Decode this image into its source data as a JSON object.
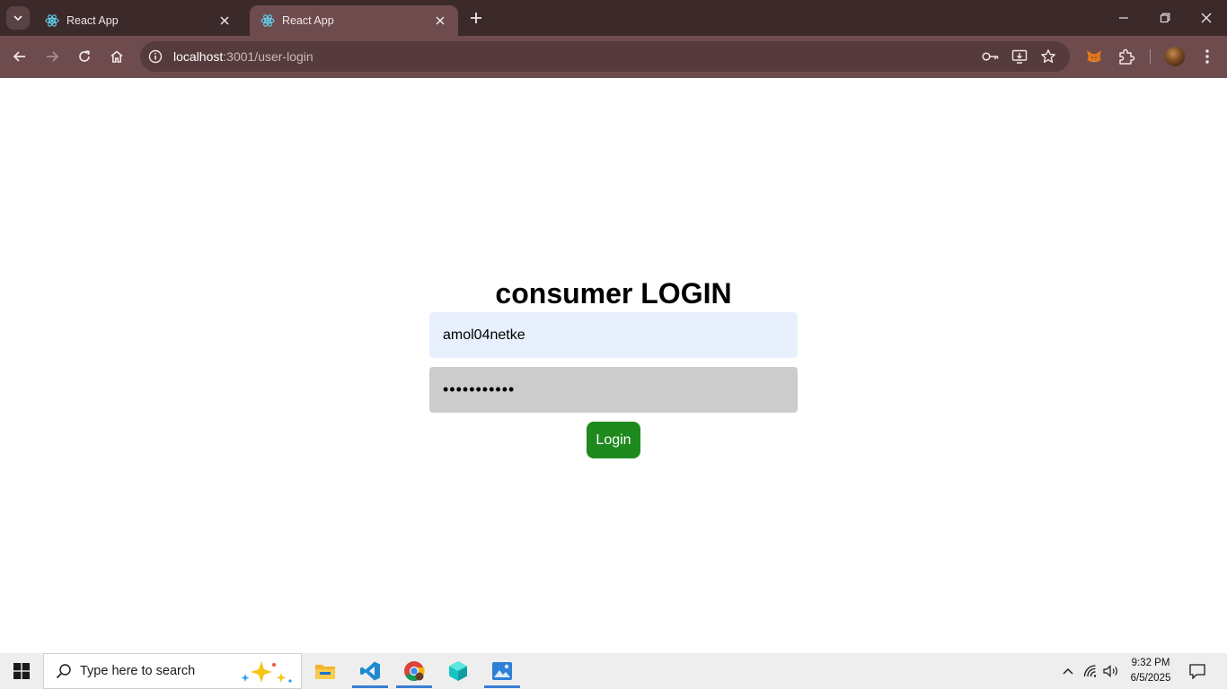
{
  "browser": {
    "tabs": [
      {
        "title": "React App",
        "active": false
      },
      {
        "title": "React App",
        "active": true
      }
    ],
    "url_host": "localhost",
    "url_rest": ":3001/user-login"
  },
  "page": {
    "title": "consumer LOGIN",
    "username_value": "amol04netke",
    "password_masked": "•••••••••••",
    "login_label": "Login"
  },
  "taskbar": {
    "search_placeholder": "Type here to search",
    "time": "9:32 PM",
    "date": "6/5/2025"
  },
  "colors": {
    "tab_strip": "#3c2a2b",
    "toolbar": "#6e4c4e",
    "login_button": "#1e8a1e",
    "username_bg": "#e8f0fe",
    "password_bg": "#cccccc"
  }
}
